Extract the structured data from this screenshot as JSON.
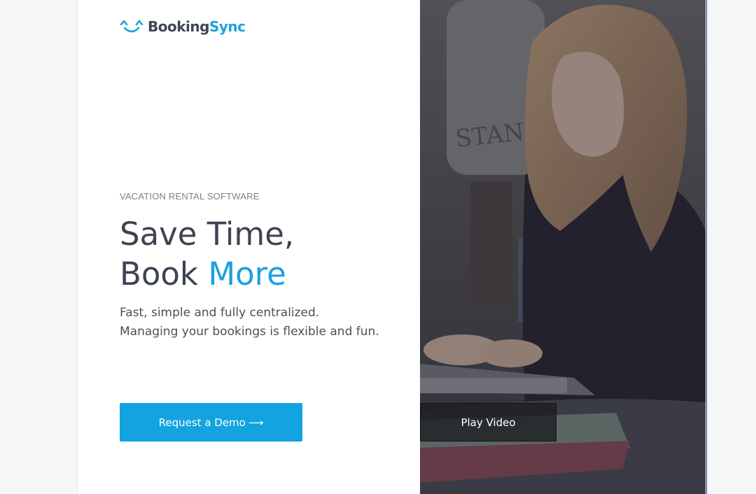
{
  "brand": {
    "name_part1": "Booking",
    "name_part2": "Sync",
    "logo_icon": "smile-eyes-icon",
    "colors": {
      "dark": "#3f4654",
      "accent": "#1ba1df"
    }
  },
  "hero": {
    "kicker": "VACATION RENTAL SOFTWARE",
    "headline_line1": "Save Time,",
    "headline_line2_prefix": "Book ",
    "headline_line2_accent": "More",
    "subtitle_line1": "Fast, simple and fully centralized.",
    "subtitle_line2": "Managing your bookings is flexible and fun.",
    "demo_button_label": "Request a Demo",
    "demo_button_arrow": "⟶",
    "play_button_label": "Play Video"
  },
  "photo": {
    "subject": "woman-typing-on-laptop-image"
  }
}
